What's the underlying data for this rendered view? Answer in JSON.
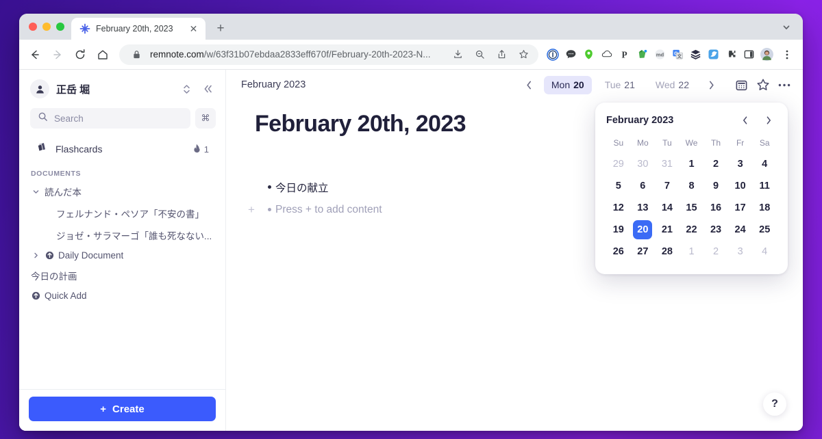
{
  "browser": {
    "tab": {
      "title": "February 20th, 2023",
      "favicon": "remnote-logo-icon",
      "close_label": "✕"
    },
    "new_tab_label": "+",
    "url_host": "remnote.com",
    "url_path": "/w/63f31b07ebdaa2833eff670f/February-20th-2023-N...",
    "nav": {
      "back": "←",
      "forward": "→",
      "reload": "⟳",
      "home": "⌂"
    },
    "extensions": [
      "1password-icon",
      "chat-bubble-icon",
      "green-shield-icon",
      "cloud-icon",
      "pocket-icon",
      "evernote-icon",
      "markdown-icon",
      "google-translate-icon",
      "layers-icon",
      "bird-icon",
      "puzzle-icon",
      "sidepanel-icon",
      "profile-avatar-icon"
    ]
  },
  "sidebar": {
    "user_name": "正岳 堀",
    "search": {
      "placeholder": "Search",
      "shortcut": "⌘"
    },
    "flashcards": {
      "label": "Flashcards",
      "streak_count": "1"
    },
    "documents_heading": "DOCUMENTS",
    "tree": [
      {
        "label": "読んだ本",
        "caret": "down",
        "indent": false,
        "badge": false
      },
      {
        "label": "フェルナンド・ペソア「不安の書」",
        "caret": "none",
        "indent": true,
        "badge": false
      },
      {
        "label": "ジョゼ・サラマーゴ「誰も死なない...",
        "caret": "none",
        "indent": true,
        "badge": false
      },
      {
        "label": "Daily Document",
        "caret": "right",
        "indent": false,
        "badge": true
      },
      {
        "label": "今日の計画",
        "caret": "none",
        "indent": false,
        "badge": false
      },
      {
        "label": "Quick Add",
        "caret": "none",
        "indent": false,
        "badge": true
      }
    ],
    "create_label": "Create",
    "create_plus": "+"
  },
  "main": {
    "month_label": "February 2023",
    "prev_day_arrow": "‹",
    "next_day_arrow": "›",
    "days": [
      {
        "dow": "Mon",
        "num": "20",
        "active": true
      },
      {
        "dow": "Tue",
        "num": "21",
        "active": false
      },
      {
        "dow": "Wed",
        "num": "22",
        "active": false
      }
    ],
    "actions": [
      "calendar-icon",
      "star-icon",
      "more-options-icon"
    ],
    "doc_title": "February 20th, 2023",
    "bullets": [
      {
        "text": "今日の献立",
        "placeholder": false,
        "show_plus": false
      },
      {
        "text": "Press + to add content",
        "placeholder": true,
        "show_plus": true
      }
    ],
    "plus_gutter": "+",
    "help_label": "?"
  },
  "calendar": {
    "month": "February 2023",
    "prev": "‹",
    "next": "›",
    "dow": [
      "Su",
      "Mo",
      "Tu",
      "We",
      "Th",
      "Fr",
      "Sa"
    ],
    "weeks": [
      [
        {
          "d": "29",
          "muted": true
        },
        {
          "d": "30",
          "muted": true
        },
        {
          "d": "31",
          "muted": true
        },
        {
          "d": "1"
        },
        {
          "d": "2"
        },
        {
          "d": "3"
        },
        {
          "d": "4"
        }
      ],
      [
        {
          "d": "5"
        },
        {
          "d": "6"
        },
        {
          "d": "7"
        },
        {
          "d": "8"
        },
        {
          "d": "9"
        },
        {
          "d": "10"
        },
        {
          "d": "11"
        }
      ],
      [
        {
          "d": "12"
        },
        {
          "d": "13"
        },
        {
          "d": "14"
        },
        {
          "d": "15"
        },
        {
          "d": "16"
        },
        {
          "d": "17"
        },
        {
          "d": "18"
        }
      ],
      [
        {
          "d": "19"
        },
        {
          "d": "20",
          "today": true
        },
        {
          "d": "21"
        },
        {
          "d": "22"
        },
        {
          "d": "23"
        },
        {
          "d": "24"
        },
        {
          "d": "25"
        }
      ],
      [
        {
          "d": "26"
        },
        {
          "d": "27"
        },
        {
          "d": "28"
        },
        {
          "d": "1",
          "muted": true
        },
        {
          "d": "2",
          "muted": true
        },
        {
          "d": "3",
          "muted": true
        },
        {
          "d": "4",
          "muted": true
        }
      ]
    ]
  },
  "colors": {
    "accent_blue": "#3b5bfd",
    "today_blue": "#3b6bf5",
    "active_day_bg": "#e6e6fb",
    "desktop_purple": "#6b1fd0"
  }
}
